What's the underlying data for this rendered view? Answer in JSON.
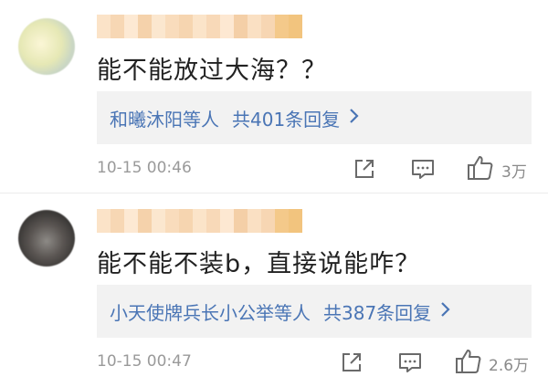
{
  "comments": [
    {
      "text": "能不能放过大海？？",
      "reply": {
        "users": "和曦沐阳等人",
        "count": "共401条回复",
        "chevron": "›"
      },
      "time": "10-15 00:46",
      "likes": "3万"
    },
    {
      "text": "能不能不装b，直接说能咋？",
      "reply": {
        "users": "小天使牌兵长小公举等人",
        "count": "共387条回复",
        "chevron": "›"
      },
      "time": "10-15 00:47",
      "likes": "2.6万"
    }
  ],
  "colors": {
    "link": "#4a75b5",
    "text": "#222222",
    "meta": "#9a9a9a",
    "reply_bg": "#f2f2f2"
  },
  "icons": [
    "share-icon",
    "comment-icon",
    "thumbs-up-icon",
    "chevron-right-icon"
  ]
}
